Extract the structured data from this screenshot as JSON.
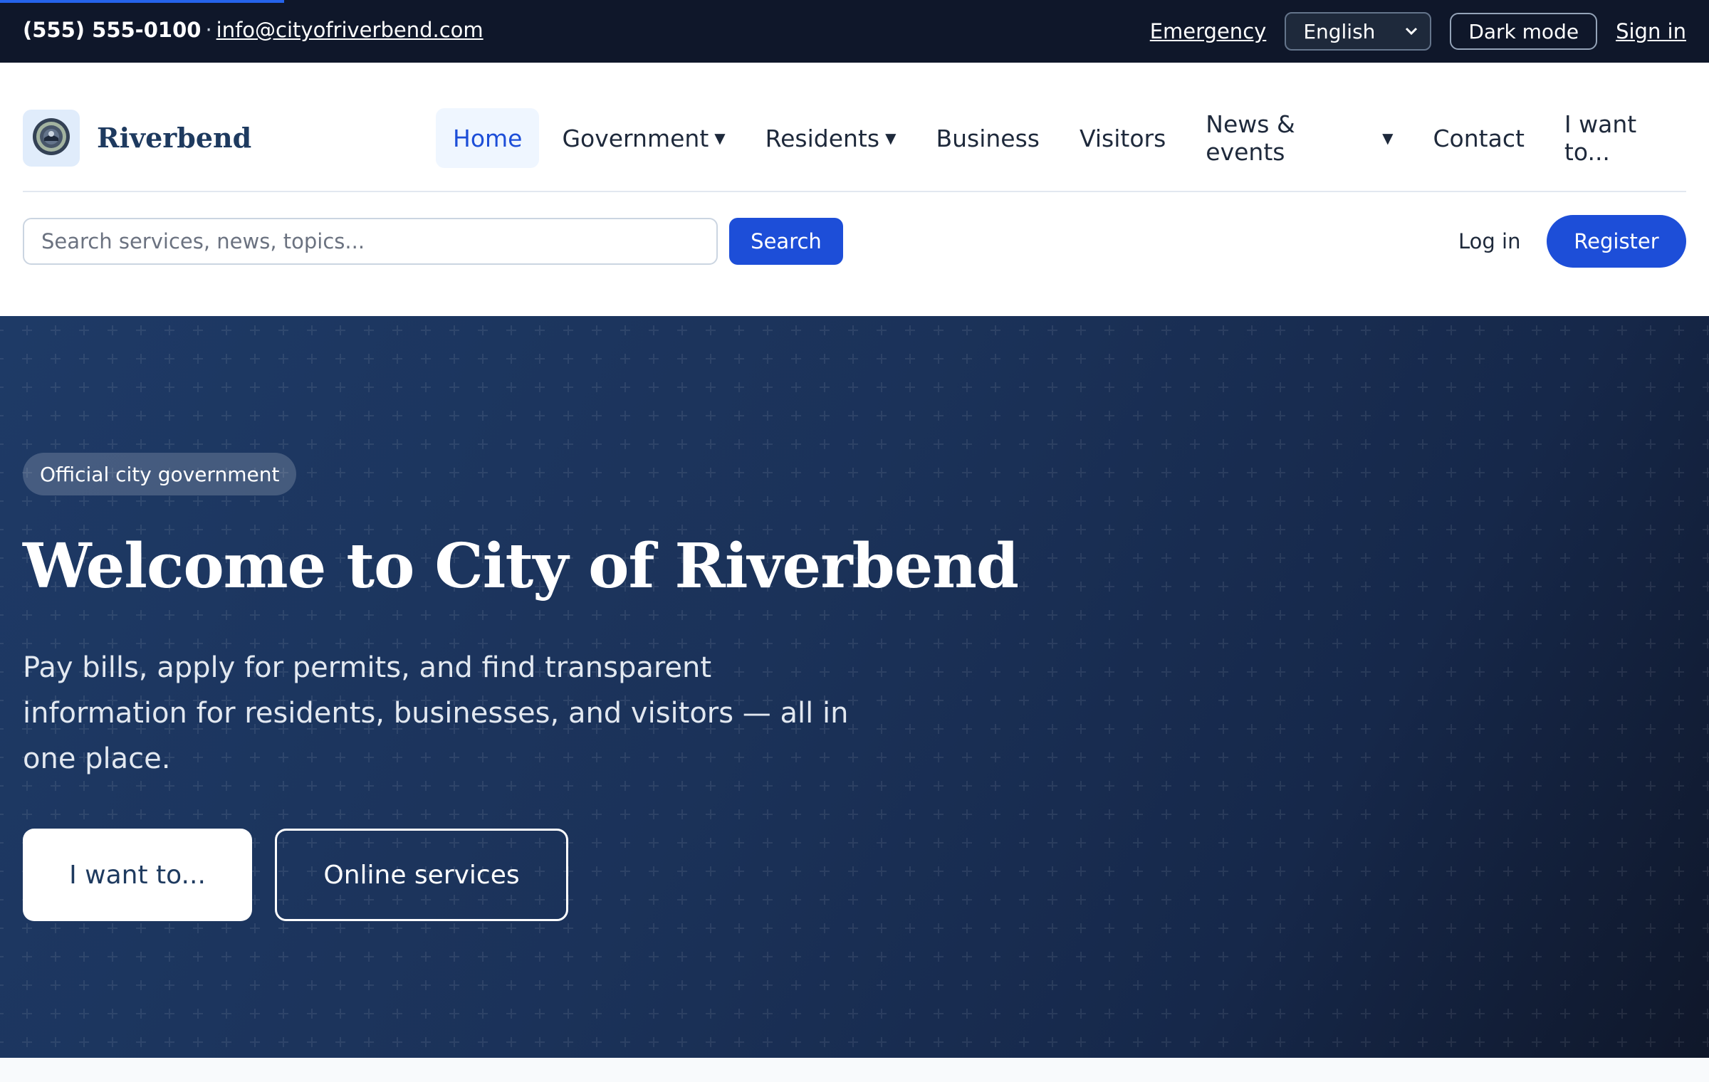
{
  "topbar": {
    "phone": "(555) 555-0100",
    "separator": "·",
    "email": "info@cityofriverbend.com",
    "emergency": "Emergency",
    "language": "English",
    "dark_mode": "Dark mode",
    "sign_in": "Sign in"
  },
  "header": {
    "brand": "Riverbend",
    "logo_icon": "city-seal-icon",
    "nav": [
      {
        "label": "Home",
        "active": true
      },
      {
        "label": "Government",
        "dropdown": true
      },
      {
        "label": "Residents",
        "dropdown": true
      },
      {
        "label": "Business"
      },
      {
        "label": "Visitors"
      },
      {
        "label": "News & events",
        "dropdown": true
      },
      {
        "label": "Contact"
      },
      {
        "label": "I want to..."
      }
    ],
    "search": {
      "placeholder": "Search services, news, topics...",
      "button": "Search"
    },
    "login": "Log in",
    "register": "Register"
  },
  "hero": {
    "badge": "Official city government",
    "title": "Welcome to City of Riverbend",
    "lead": "Pay bills, apply for permits, and find transparent information for residents, businesses, and visitors — all in one place.",
    "cta_primary": "I want to...",
    "cta_secondary": "Online services"
  },
  "colors": {
    "topbar_bg": "#0f172a",
    "accent": "#1d4ed8",
    "hero_bg": "#1b3259",
    "brand_text": "#1e3a5f"
  }
}
